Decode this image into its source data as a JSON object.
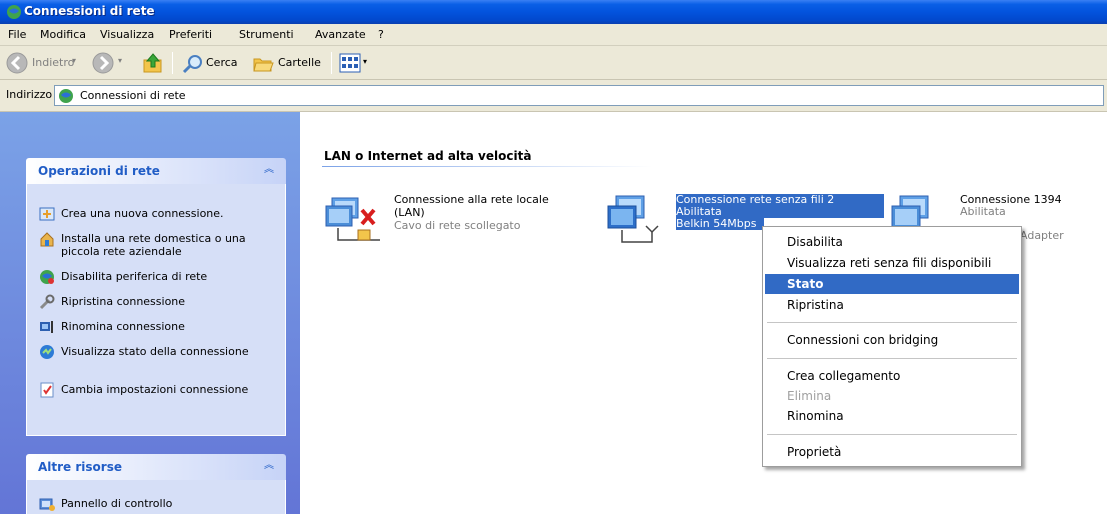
{
  "window": {
    "title": "Connessioni di rete"
  },
  "menubar": [
    "File",
    "Modifica",
    "Visualizza",
    "Preferiti",
    "Strumenti",
    "Avanzate",
    "?"
  ],
  "toolbar": {
    "back": "Indietro",
    "search": "Cerca",
    "folders": "Cartelle"
  },
  "address": {
    "label": "Indirizzo",
    "value": "Connessioni di rete"
  },
  "sidebar": {
    "network_tasks": {
      "title": "Operazioni di rete",
      "items": [
        {
          "label": "Crea una nuova connessione.",
          "icon": "new-connection-icon"
        },
        {
          "label": "Installa una rete domestica o una piccola rete aziendale",
          "icon": "home-network-icon"
        },
        {
          "label": "Disabilita periferica di rete",
          "icon": "disable-device-icon"
        },
        {
          "label": "Ripristina connessione",
          "icon": "repair-icon"
        },
        {
          "label": "Rinomina connessione",
          "icon": "rename-icon"
        },
        {
          "label": "Visualizza stato della connessione",
          "icon": "status-icon"
        },
        {
          "label": "Cambia impostazioni connessione",
          "icon": "settings-icon"
        }
      ]
    },
    "other_places": {
      "title": "Altre risorse",
      "items": [
        {
          "label": "Pannello di controllo",
          "icon": "control-panel-icon"
        }
      ]
    }
  },
  "main": {
    "group_title": "LAN o Internet ad alta velocità",
    "connections": [
      {
        "name": "Connessione alla rete locale (LAN)",
        "name_line1": "Connessione alla rete locale",
        "name_line2": "(LAN)",
        "status": "Cavo di rete scollegato",
        "device": ""
      },
      {
        "name": "Connessione rete senza fili 2",
        "status": "Abilitata",
        "device": "Belkin 54Mbps",
        "selected": true
      },
      {
        "name": "Connessione 1394",
        "status": "Abilitata",
        "device": "Adapter"
      }
    ]
  },
  "context_menu": {
    "items": [
      {
        "label": "Disabilita",
        "state": "normal"
      },
      {
        "label": "Visualizza reti senza fili disponibili",
        "state": "normal"
      },
      {
        "label": "Stato",
        "state": "highlighted"
      },
      {
        "label": "Ripristina",
        "state": "normal"
      },
      {
        "label": "Connessioni con bridging",
        "state": "normal"
      },
      {
        "label": "Crea collegamento",
        "state": "normal"
      },
      {
        "label": "Elimina",
        "state": "disabled"
      },
      {
        "label": "Rinomina",
        "state": "normal"
      },
      {
        "label": "Proprietà",
        "state": "normal"
      }
    ]
  },
  "colors": {
    "title_bar": "#0353dd",
    "task_pane": "#6375d6",
    "selection": "#316ac5",
    "panel_title": "#215dc6"
  }
}
